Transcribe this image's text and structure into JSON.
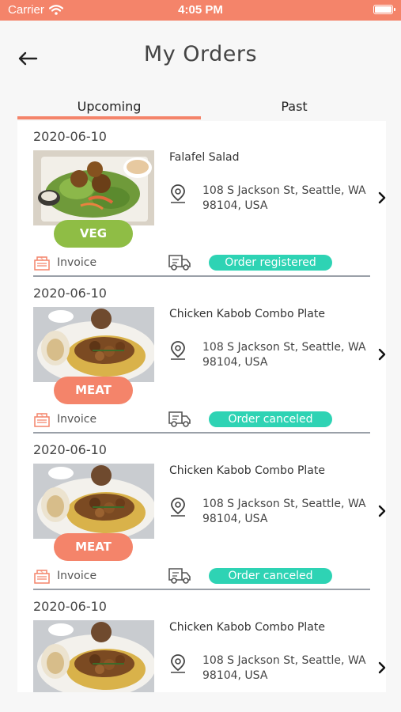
{
  "status_bar": {
    "carrier": "Carrier",
    "time": "4:05 PM"
  },
  "header": {
    "title": "My Orders"
  },
  "tabs": [
    {
      "label": "Upcoming",
      "active": true
    },
    {
      "label": "Past",
      "active": false
    }
  ],
  "colors": {
    "accent": "#f4846a",
    "veg": "#8fbd45",
    "status": "#2ed3b4"
  },
  "orders": [
    {
      "date": "2020-06-10",
      "name": "Falafel Salad",
      "tag": "VEG",
      "address": "108 S Jackson St, Seattle, WA 98104, USA",
      "invoice_label": "Invoice",
      "status": "Order registered",
      "photo": "falafel-salad-photo"
    },
    {
      "date": "2020-06-10",
      "name": "Chicken Kabob Combo Plate",
      "tag": "MEAT",
      "address": "108 S Jackson St, Seattle, WA 98104, USA",
      "invoice_label": "Invoice",
      "status": "Order canceled",
      "photo": "kabob-plate-photo"
    },
    {
      "date": "2020-06-10",
      "name": "Chicken Kabob Combo Plate",
      "tag": "MEAT",
      "address": "108 S Jackson St, Seattle, WA 98104, USA",
      "invoice_label": "Invoice",
      "status": "Order canceled",
      "photo": "kabob-plate-photo"
    },
    {
      "date": "2020-06-10",
      "name": "Chicken Kabob Combo Plate",
      "address": "108 S Jackson St, Seattle, WA 98104, USA",
      "photo": "kabob-plate-photo"
    }
  ]
}
